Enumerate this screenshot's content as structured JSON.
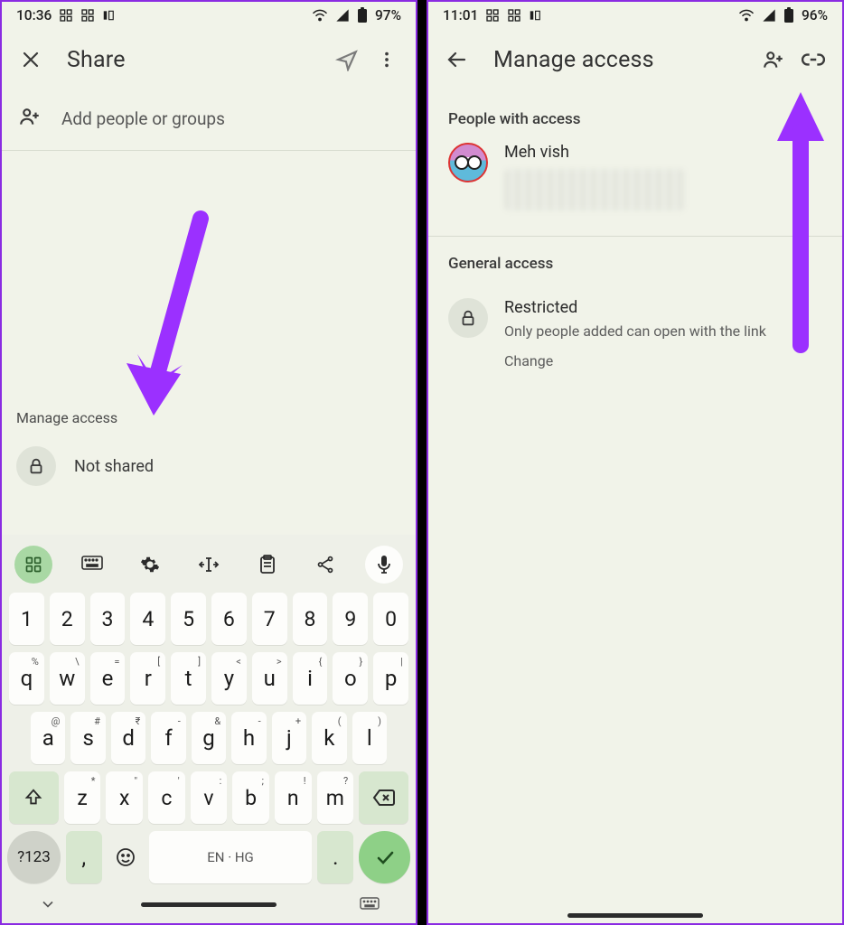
{
  "left": {
    "status": {
      "time": "10:36",
      "battery": "97%"
    },
    "header": {
      "title": "Share"
    },
    "add": {
      "placeholder": "Add people or groups"
    },
    "manage": {
      "label": "Manage access",
      "status": "Not shared"
    },
    "keyboard": {
      "row_num": [
        "1",
        "2",
        "3",
        "4",
        "5",
        "6",
        "7",
        "8",
        "9",
        "0"
      ],
      "row_q": [
        "q",
        "w",
        "e",
        "r",
        "t",
        "y",
        "u",
        "i",
        "o",
        "p"
      ],
      "row_q_sup": [
        "%",
        "\\",
        "=",
        "[",
        "]",
        "<",
        ">",
        "{",
        "}",
        "|"
      ],
      "row_a": [
        "a",
        "s",
        "d",
        "f",
        "g",
        "h",
        "j",
        "k",
        "l"
      ],
      "row_a_sup": [
        "@",
        "#",
        "₹",
        "-",
        "&",
        "-",
        "+",
        "(",
        ")"
      ],
      "row_z": [
        "z",
        "x",
        "c",
        "v",
        "b",
        "n",
        "m"
      ],
      "row_z_sup": [
        "*",
        "\"",
        "'",
        ":",
        ";",
        "!",
        "?"
      ],
      "sym": "?123",
      "space": "EN · HG",
      "comma": ",",
      "period": "."
    }
  },
  "right": {
    "status": {
      "time": "11:01",
      "battery": "96%"
    },
    "header": {
      "title": "Manage access"
    },
    "people": {
      "heading": "People with access",
      "person_name": "Meh vish"
    },
    "general": {
      "heading": "General access",
      "title": "Restricted",
      "subtitle": "Only people added can open with the link",
      "change": "Change"
    }
  }
}
